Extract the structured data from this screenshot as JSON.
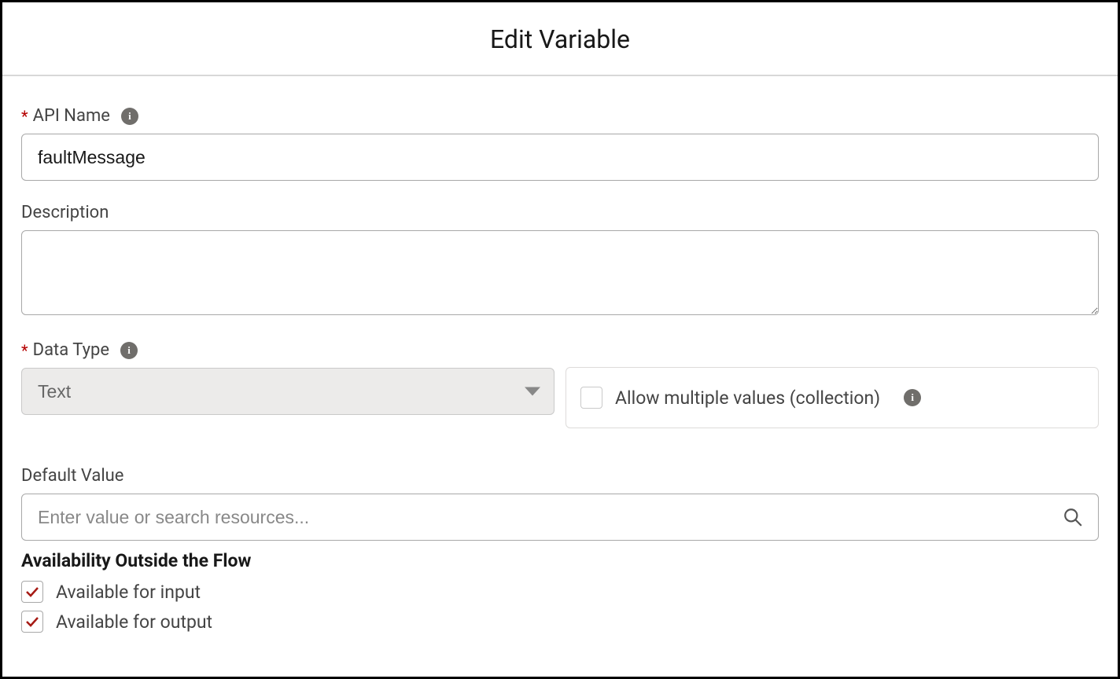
{
  "modal": {
    "title": "Edit Variable"
  },
  "fields": {
    "api_name": {
      "label": "API Name",
      "value": "faultMessage",
      "required": true
    },
    "description": {
      "label": "Description",
      "value": ""
    },
    "data_type": {
      "label": "Data Type",
      "value": "Text",
      "required": true
    },
    "allow_multiple": {
      "label": "Allow multiple values (collection)",
      "checked": false
    },
    "default_value": {
      "label": "Default Value",
      "placeholder": "Enter value or search resources...",
      "value": ""
    }
  },
  "availability": {
    "heading": "Availability Outside the Flow",
    "input": {
      "label": "Available for input",
      "checked": true
    },
    "output": {
      "label": "Available for output",
      "checked": true
    }
  }
}
